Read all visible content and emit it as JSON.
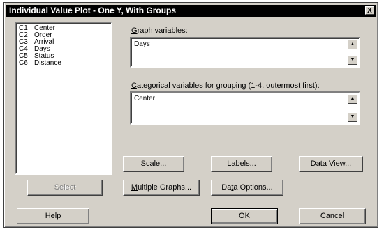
{
  "dialog": {
    "title": "Individual Value Plot - One Y, With Groups",
    "close_glyph": "X"
  },
  "variables": [
    {
      "num": "C1",
      "name": "Center"
    },
    {
      "num": "C2",
      "name": "Order"
    },
    {
      "num": "C3",
      "name": "Arrival"
    },
    {
      "num": "C4",
      "name": "Days"
    },
    {
      "num": "C5",
      "name": "Status"
    },
    {
      "num": "C6",
      "name": "Distance"
    }
  ],
  "graph_variables": {
    "label_underlined": "G",
    "label_rest": "raph variables:",
    "value": "Days"
  },
  "categorical": {
    "label_underlined": "C",
    "label_rest": "ategorical variables for grouping (1-4, outermost first):",
    "value": "Center"
  },
  "buttons": {
    "scale": {
      "u": "S",
      "rest": "cale..."
    },
    "labels": {
      "u": "L",
      "rest": "abels..."
    },
    "data_view": {
      "u": "D",
      "rest": "ata View..."
    },
    "select": "Select",
    "multiple_graphs": {
      "u": "M",
      "rest": "ultiple Graphs..."
    },
    "data_options": {
      "pre": "Da",
      "u": "t",
      "rest": "a Options..."
    },
    "help": "Help",
    "ok": {
      "u": "O",
      "rest": "K"
    },
    "cancel": "Cancel"
  }
}
